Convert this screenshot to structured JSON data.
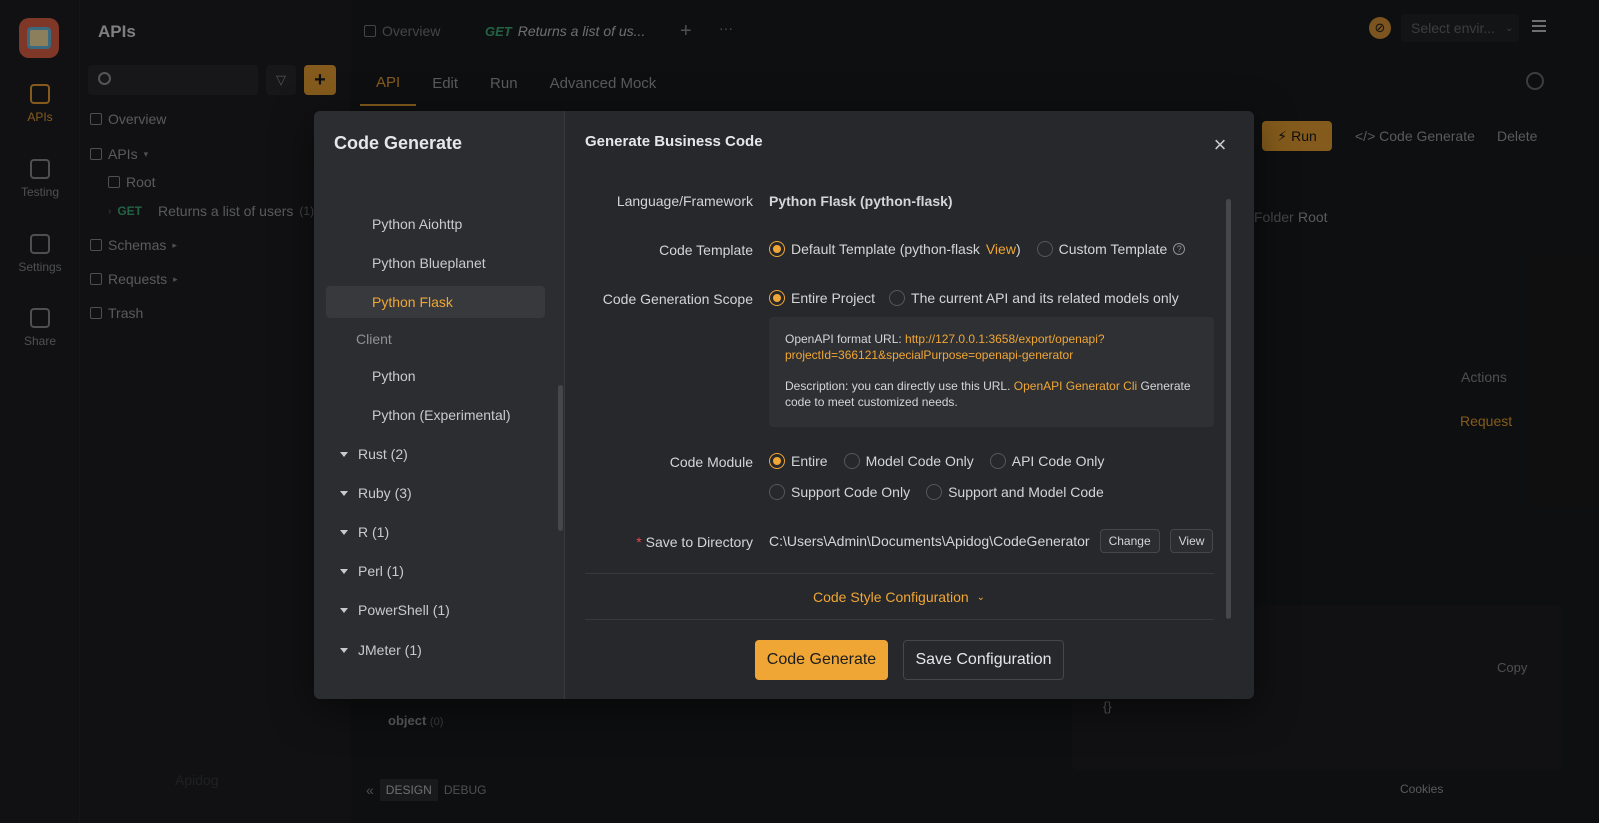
{
  "rail": {
    "items": [
      {
        "label": "APIs",
        "icon": "apis-icon",
        "active": true
      },
      {
        "label": "Testing",
        "icon": "testing-icon"
      },
      {
        "label": "Settings",
        "icon": "settings-icon"
      },
      {
        "label": "Share",
        "icon": "share-icon"
      }
    ]
  },
  "sidebar": {
    "title": "APIs",
    "tree": {
      "overview": "Overview",
      "apis": "APIs",
      "root": "Root",
      "get_method": "GET",
      "get_label": "Returns a list of users",
      "get_count": "(1)",
      "schemas": "Schemas",
      "requests": "Requests",
      "trash": "Trash"
    },
    "watermark": "Apidog"
  },
  "topbar": {
    "tab_overview": "Overview",
    "tab_get_method": "GET",
    "tab_get_label": "Returns a list of us...",
    "env_placeholder": "Select envir..."
  },
  "subtabs": [
    "API",
    "Edit",
    "Run",
    "Advanced Mock"
  ],
  "background": {
    "run": "Run",
    "code_generate": "Code Generate",
    "delete": "Delete",
    "folder": "Folder",
    "root": "Root",
    "actions": "Actions",
    "request": "Request",
    "copy": "Copy",
    "object": "object",
    "object_count": "(0)",
    "braces": "{}"
  },
  "modal": {
    "left_title": "Code Generate",
    "languages": [
      {
        "label": "Python Aiohttp",
        "kind": "child"
      },
      {
        "label": "Python Blueplanet",
        "kind": "child"
      },
      {
        "label": "Python Flask",
        "kind": "child",
        "selected": true
      },
      {
        "label": "Client",
        "kind": "group"
      },
      {
        "label": "Python",
        "kind": "child"
      },
      {
        "label": "Python (Experimental)",
        "kind": "child"
      },
      {
        "label": "Rust (2)",
        "kind": "collapsed"
      },
      {
        "label": "Ruby (3)",
        "kind": "collapsed"
      },
      {
        "label": "R (1)",
        "kind": "collapsed"
      },
      {
        "label": "Perl (1)",
        "kind": "collapsed"
      },
      {
        "label": "PowerShell (1)",
        "kind": "collapsed"
      },
      {
        "label": "JMeter (1)",
        "kind": "collapsed"
      }
    ],
    "title": "Generate Business Code",
    "language_label": "Language/Framework",
    "language_value": "Python Flask (python-flask)",
    "template_label": "Code Template",
    "template_default": "Default Template (python-flask",
    "template_view": "View",
    "template_close": ")",
    "template_custom": "Custom Template",
    "scope_label": "Code Generation Scope",
    "scope_entire": "Entire Project",
    "scope_current": "The current API and its related models only",
    "info_url_prefix": "OpenAPI format URL: ",
    "info_url_line1": "http://127.0.0.1:3658/export/openapi?",
    "info_url_line2": "projectId=366121&specialPurpose=openapi-generator",
    "info_desc_prefix": "Description: you can directly use this URL. ",
    "info_desc_link": "OpenAPI Generator Cli",
    "info_desc_suffix": " Generate",
    "info_desc_line2": "code to meet customized needs.",
    "module_label": "Code Module",
    "module_entire": "Entire",
    "module_model": "Model Code Only",
    "module_api": "API Code Only",
    "module_support": "Support Code Only",
    "module_support_model": "Support and Model Code",
    "save_label": "Save to Directory",
    "required_mark": "*",
    "save_path": "C:\\Users\\Admin\\Documents\\Apidog\\CodeGenerator",
    "change_btn": "Change",
    "view_btn": "View",
    "code_style": "Code Style Configuration",
    "generate_btn": "Code Generate",
    "save_config_btn": "Save Configuration"
  },
  "bottombar": {
    "design": "DESIGN",
    "debug": "DEBUG",
    "cookies": "Cookies"
  },
  "colors": {
    "accent": "#f0a634",
    "get": "#3fb27f",
    "bg": "#1b1c1e"
  }
}
